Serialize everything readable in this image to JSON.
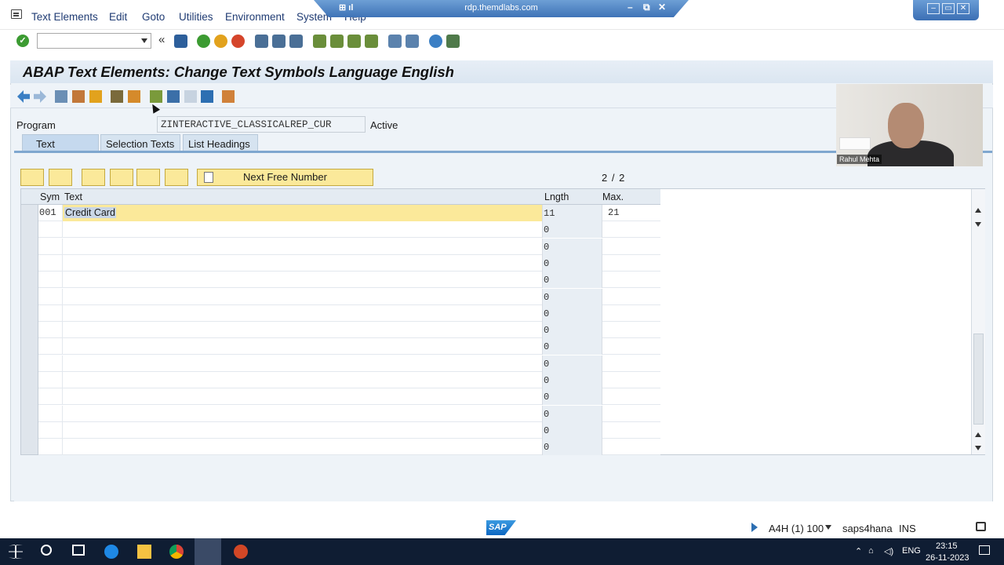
{
  "menu": {
    "items": [
      "Text Elements",
      "Edit",
      "Goto",
      "Utilities",
      "Environment",
      "System",
      "Help"
    ]
  },
  "rdp": {
    "host": "rdp.themdlabs.com"
  },
  "title": "ABAP Text Elements: Change Text Symbols Language English",
  "program": {
    "label": "Program",
    "value": "ZINTERACTIVE_CLASSICALREP_CUR",
    "status": "Active"
  },
  "tabs": [
    {
      "label": "Text Symbols",
      "active": true
    },
    {
      "label": "Selection Texts",
      "active": false
    },
    {
      "label": "List Headings",
      "active": false
    }
  ],
  "table_toolbar": {
    "next_free_label": "Next Free Number",
    "counter": "2 / 2"
  },
  "table": {
    "columns": [
      "Sym",
      "Text",
      "Lngth",
      "Max."
    ],
    "rows": [
      {
        "sym": "001",
        "text": "Credit Card",
        "len": "11",
        "max": "21"
      },
      {
        "sym": "",
        "text": "",
        "len": "0",
        "max": ""
      },
      {
        "sym": "",
        "text": "",
        "len": "0",
        "max": ""
      },
      {
        "sym": "",
        "text": "",
        "len": "0",
        "max": ""
      },
      {
        "sym": "",
        "text": "",
        "len": "0",
        "max": ""
      },
      {
        "sym": "",
        "text": "",
        "len": "0",
        "max": ""
      },
      {
        "sym": "",
        "text": "",
        "len": "0",
        "max": ""
      },
      {
        "sym": "",
        "text": "",
        "len": "0",
        "max": ""
      },
      {
        "sym": "",
        "text": "",
        "len": "0",
        "max": ""
      },
      {
        "sym": "",
        "text": "",
        "len": "0",
        "max": ""
      },
      {
        "sym": "",
        "text": "",
        "len": "0",
        "max": ""
      },
      {
        "sym": "",
        "text": "",
        "len": "0",
        "max": ""
      },
      {
        "sym": "",
        "text": "",
        "len": "0",
        "max": ""
      },
      {
        "sym": "",
        "text": "",
        "len": "0",
        "max": ""
      },
      {
        "sym": "",
        "text": "",
        "len": "0",
        "max": ""
      }
    ]
  },
  "status_bar": {
    "system": "A4H (1) 100",
    "server": "saps4hana",
    "mode": "INS"
  },
  "webcam": {
    "name": "Rahul Mehta"
  },
  "taskbar": {
    "language": "ENG",
    "time": "23:15",
    "date": "26-11-2023"
  },
  "colors": {
    "accent": "#1f3b73",
    "highlight": "#fbe99a",
    "tab_line": "#7fa7cf",
    "background": "#eef3f8"
  }
}
